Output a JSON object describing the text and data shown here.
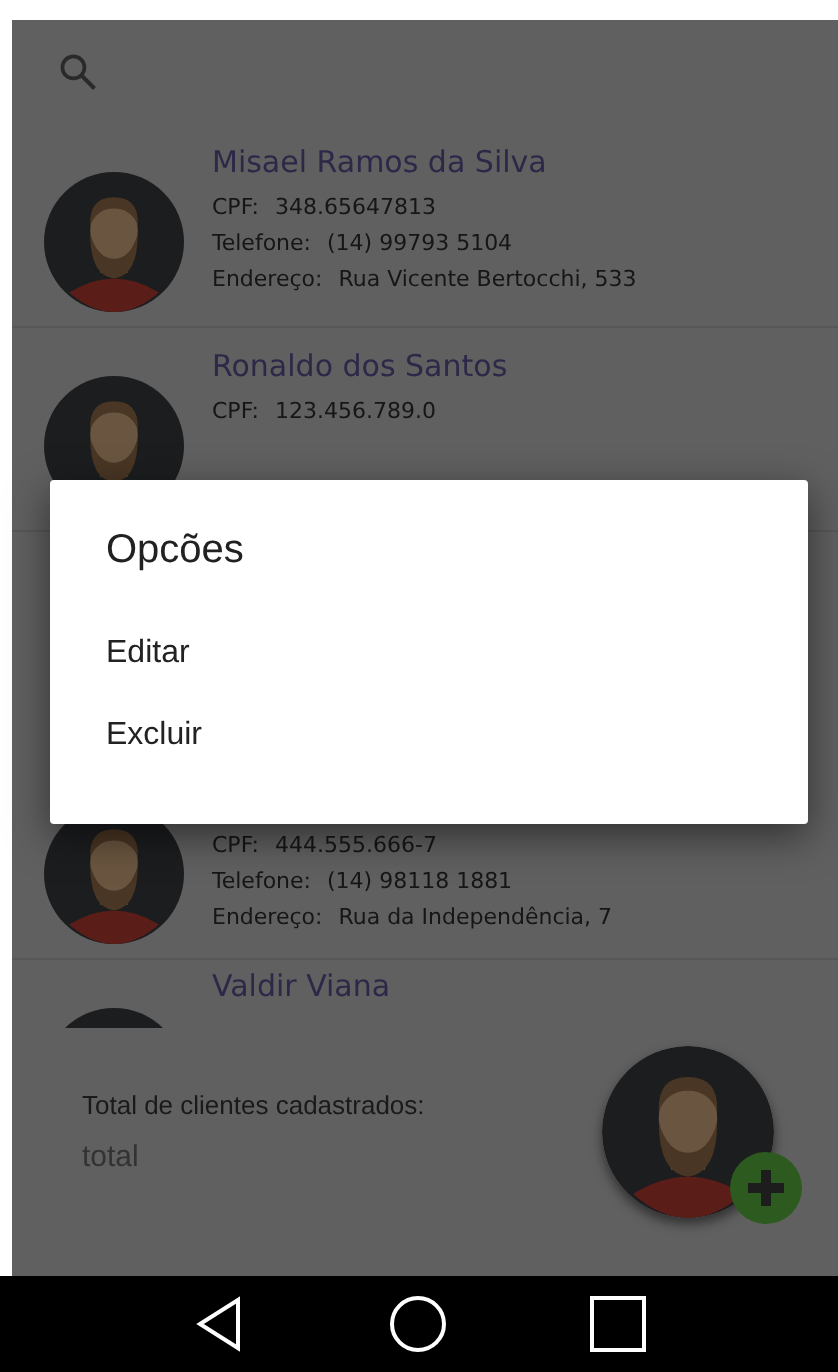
{
  "dialog": {
    "title": "Opcões",
    "options": [
      "Editar",
      "Excluir"
    ]
  },
  "clients_above": [
    {
      "name": "Misael Ramos da Silva",
      "lines": [
        {
          "label": "CPF:",
          "value": "348.65647813"
        },
        {
          "label": "Telefone:",
          "value": "(14) 99793 5104"
        },
        {
          "label": "Endereço:",
          "value": "Rua Vicente Bertocchi, 533"
        }
      ]
    },
    {
      "name": "Ronaldo dos Santos",
      "lines": [
        {
          "label": "CPF:",
          "value": "123.456.789.0"
        }
      ]
    }
  ],
  "clients_below": [
    {
      "lines": [
        {
          "label": "CPF:",
          "value": "444.555.666-7"
        },
        {
          "label": "Telefone:",
          "value": "(14) 98118 1881"
        },
        {
          "label": "Endereço:",
          "value": "Rua da Independência, 7"
        }
      ]
    },
    {
      "name": "Valdir Viana"
    }
  ],
  "footer": {
    "label": "Total de clientes cadastrados:",
    "value": "total"
  }
}
